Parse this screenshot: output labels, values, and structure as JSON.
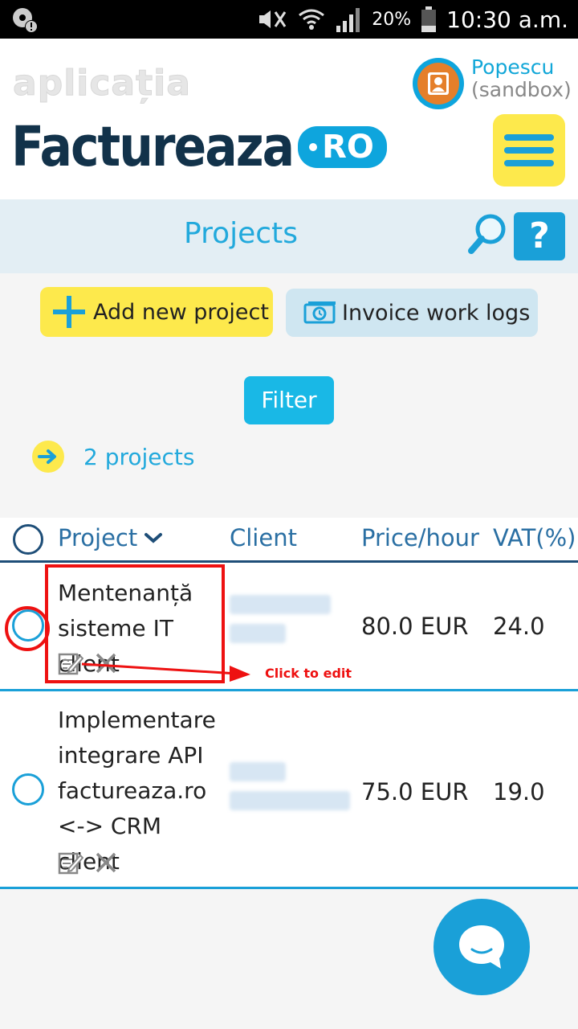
{
  "status_bar": {
    "battery": "20%",
    "time": "10:30 a.m."
  },
  "header": {
    "brand_small": "aplicația",
    "brand_main": "Factureaza",
    "brand_suffix": "RO",
    "user_name": "Popescu",
    "user_sub": "(sandbox)"
  },
  "titlebar": {
    "title": "Projects",
    "help_label": "?"
  },
  "actions": {
    "add_label": "Add new project",
    "invoice_label": "Invoice work logs",
    "filter_label": "Filter",
    "count_label": "2 projects"
  },
  "table": {
    "headers": {
      "project": "Project",
      "client": "Client",
      "price": "Price/hour",
      "vat": "VAT(%)"
    },
    "rows": [
      {
        "project": "Mentenanță sisteme IT client",
        "price": "80.0 EUR",
        "vat": "24.0"
      },
      {
        "project": "Implementare integrare API factureaza.ro <-> CRM client",
        "price": "75.0 EUR",
        "vat": "19.0"
      }
    ]
  },
  "annotation": {
    "label": "Click to edit"
  },
  "colors": {
    "accent": "#1aa0d8",
    "yellow": "#fde94c",
    "navy": "#12324a",
    "annotation_red": "#ee1111"
  }
}
